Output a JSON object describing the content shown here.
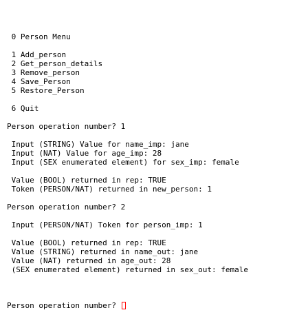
{
  "terminal": {
    "lines": [
      " 0 Person Menu",
      "",
      " 1 Add_person",
      " 2 Get_person_details",
      " 3 Remove_person",
      " 4 Save_Person",
      " 5 Restore_Person",
      "",
      " 6 Quit",
      "",
      "Person operation number? 1",
      "",
      " Input (STRING) Value for name_imp: jane",
      " Input (NAT) Value for age_imp: 28",
      " Input (SEX enumerated element) for sex_imp: female",
      "",
      " Value (BOOL) returned in rep: TRUE",
      " Token (PERSON/NAT) returned in new_person: 1",
      "",
      "Person operation number? 2",
      "",
      " Input (PERSON/NAT) Token for person_imp: 1",
      "",
      " Value (BOOL) returned in rep: TRUE",
      " Value (STRING) returned in name_out: jane",
      " Value (NAT) returned in age_out: 28",
      " (SEX enumerated element) returned in sex_out: female",
      ""
    ],
    "prompt": "Person operation number? "
  }
}
